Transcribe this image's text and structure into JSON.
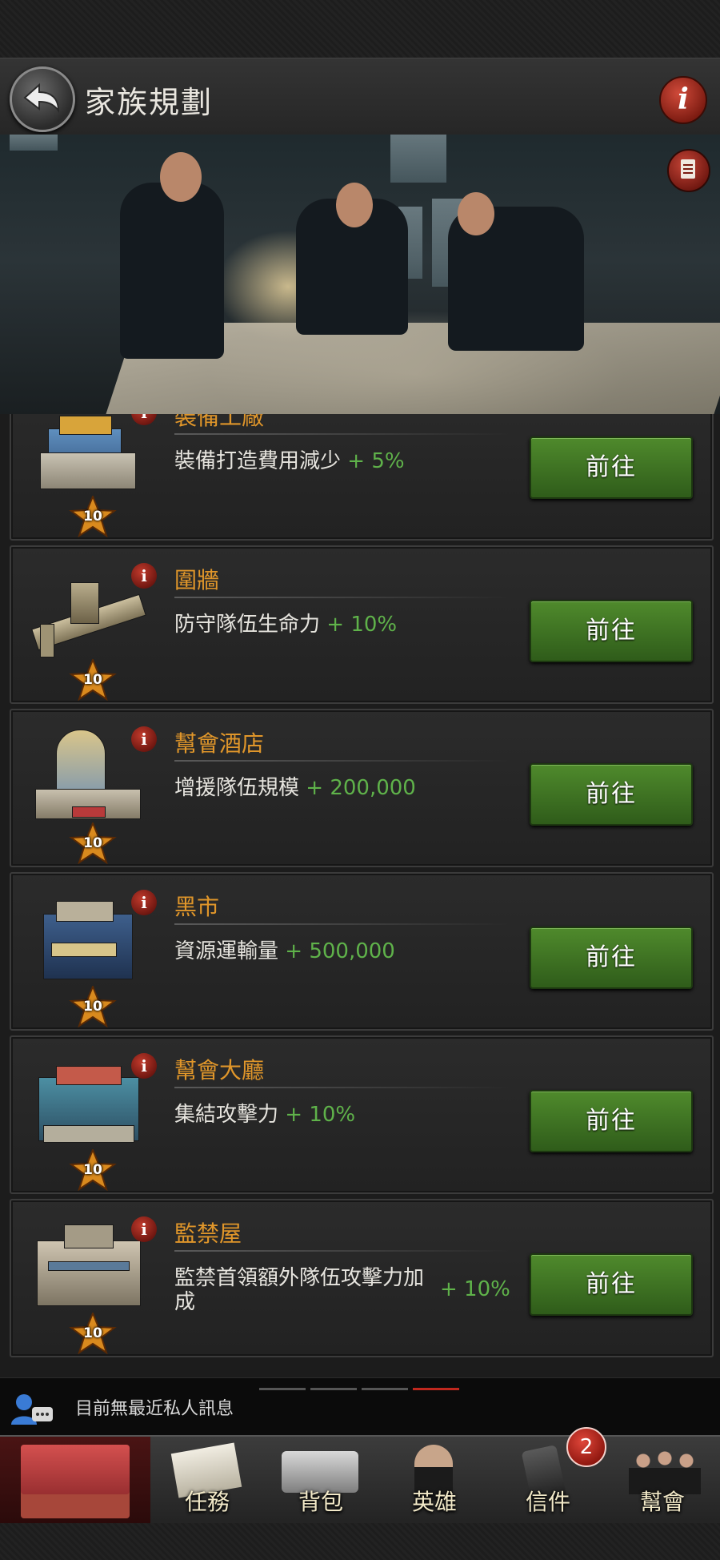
{
  "header": {
    "title": "家族規劃"
  },
  "buildings": [
    {
      "name": "裝備工廠",
      "effect": "裝備打造費用減少",
      "bonus": "+ 5%",
      "level": "10",
      "button": "前往"
    },
    {
      "name": "圍牆",
      "effect": "防守隊伍生命力",
      "bonus": "+ 10%",
      "level": "10",
      "button": "前往"
    },
    {
      "name": "幫會酒店",
      "effect": "增援隊伍規模",
      "bonus": "+ 200,000",
      "level": "10",
      "button": "前往"
    },
    {
      "name": "黑市",
      "effect": "資源運輸量",
      "bonus": "+ 500,000",
      "level": "10",
      "button": "前往"
    },
    {
      "name": "幫會大廳",
      "effect": "集結攻擊力",
      "bonus": "+ 10%",
      "level": "10",
      "button": "前往"
    },
    {
      "name": "監禁屋",
      "effect": "監禁首領額外隊伍攻擊力加成",
      "bonus": "+ 10%",
      "level": "10",
      "button": "前往"
    }
  ],
  "message_bar": {
    "text": "目前無最近私人訊息"
  },
  "nav": {
    "tabs": [
      "",
      "任務",
      "背包",
      "英雄",
      "信件",
      "幫會"
    ],
    "mail_badge": "2"
  },
  "colors": {
    "accent_orange": "#e0962a",
    "bonus_green": "#5fb24a",
    "button_green": "#3f7424",
    "alert_red": "#c0281e"
  }
}
